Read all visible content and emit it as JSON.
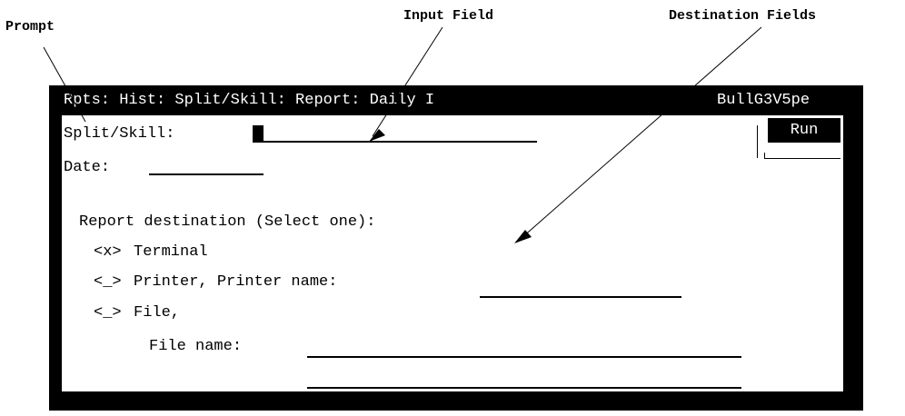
{
  "callouts": {
    "prompt": "Prompt",
    "input_field": "Input Field",
    "destination_fields": "Destination Fields"
  },
  "screen": {
    "title_left": "Rpts: Hist: Split/Skill: Report: Daily I",
    "title_right": "BullG3V5pe",
    "split_skill_label": "Split/Skill:",
    "date_label": "Date:",
    "run_label": "Run",
    "destination_heading": "Report destination (Select one):",
    "options": [
      {
        "marker": "<x>",
        "label": "Terminal"
      },
      {
        "marker": "<_>",
        "label": "Printer, Printer name:"
      },
      {
        "marker": "<_>",
        "label": "File,"
      }
    ],
    "file_name_label": "File name:"
  }
}
